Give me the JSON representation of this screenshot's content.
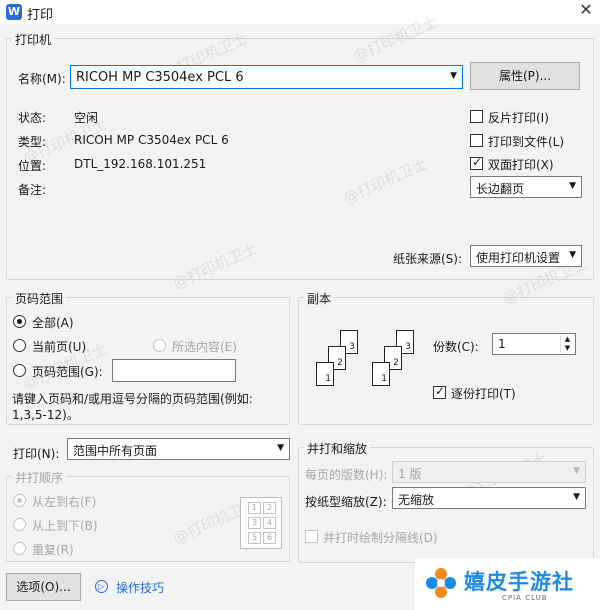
{
  "window": {
    "title": "打印",
    "app_icon": "W"
  },
  "printer": {
    "group_label": "打印机",
    "name_label": "名称(M):",
    "name_value": "RICOH MP C3504ex PCL 6",
    "properties_button": "属性(P)...",
    "status_label": "状态:",
    "status_value": "空闲",
    "type_label": "类型:",
    "type_value": "RICOH MP C3504ex PCL 6",
    "location_label": "位置:",
    "location_value": "DTL_192.168.101.251",
    "comment_label": "备注:",
    "reverse_print": "反片打印(I)",
    "print_to_file": "打印到文件(L)",
    "duplex": "双面打印(X)",
    "duplex_mode": "长边翻页",
    "paper_source_label": "纸张来源(S):",
    "paper_source_value": "使用打印机设置"
  },
  "page_range": {
    "group_label": "页码范围",
    "all": "全部(A)",
    "current": "当前页(U)",
    "selection": "所选内容(E)",
    "range": "页码范围(G):",
    "range_value": "",
    "hint_line1": "请键入页码和/或用逗号分隔的页码范围(例如:",
    "hint_line2": "1,3,5-12)。"
  },
  "copies": {
    "group_label": "副本",
    "count_label": "份数(C):",
    "count_value": "1",
    "collate": "逐份打印(T)",
    "sheet_labels": [
      "1",
      "2",
      "3"
    ]
  },
  "print_what": {
    "label": "打印(N):",
    "value": "范围中所有页面"
  },
  "order": {
    "group_label": "并打顺序",
    "left_to_right": "从左到右(F)",
    "top_to_bottom": "从上到下(B)",
    "repeat": "重复(R)",
    "preview_cells": [
      "1",
      "2",
      "3",
      "4",
      "5",
      "6"
    ]
  },
  "zoom": {
    "group_label": "并打和缩放",
    "pages_per_sheet_label": "每页的版数(H):",
    "pages_per_sheet_value": "1 版",
    "scale_label": "按纸型缩放(Z):",
    "scale_value": "无缩放",
    "draw_borders": "并打时绘制分隔线(D)"
  },
  "footer": {
    "options_button": "选项(O)...",
    "tips_link": "操作技巧",
    "logo_text": "嬉皮手游社",
    "logo_sub": "CPIA CLUB"
  },
  "watermark": "@打印机卫士",
  "colors": {
    "accent": "#0078d7",
    "logo_orange": "#f08a1c",
    "logo_blue": "#1f8be0"
  }
}
